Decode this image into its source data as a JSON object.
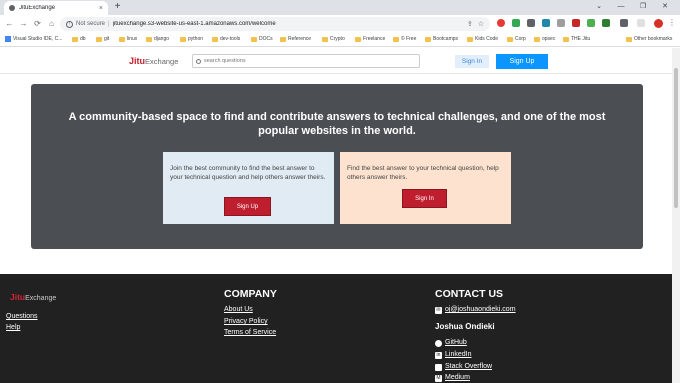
{
  "browser": {
    "tab_title": "JituExchange",
    "tab_close": "×",
    "new_tab": "+",
    "window_controls": [
      "⌄",
      "—",
      "❐",
      "✕"
    ],
    "nav": {
      "back": "←",
      "forward": "→",
      "reload": "⟳",
      "home": "⌂"
    },
    "not_secure": "Not secure",
    "url": "jituexchange.s3-website-us-east-1.amazonaws.com/welcome",
    "bookmarks": [
      "Visual Studio IDE, C...",
      "db",
      "git",
      "linux",
      "django",
      "python",
      "dev-tools",
      "DOCs",
      "Reference",
      "Crypto",
      "Freelance",
      "© Free",
      "Bootcamps",
      "Kids Code",
      "Corp",
      "opsec",
      "THE Jitu"
    ],
    "other_bookmarks": "Other bookmarks"
  },
  "header": {
    "logo_main": "Jitu",
    "logo_sub": "Exchange",
    "search_placeholder": "search questions",
    "signin_label": "Sign In",
    "signup_label": "Sign Up"
  },
  "hero": {
    "title": "A community-based space to find and contribute answers to technical challenges, and one of the most popular websites in the world.",
    "card_left_text": "Join the best community to find the best answer to your technical question and help others answer theirs.",
    "card_left_button": "Sign Up",
    "card_right_text": "Find the best answer to your technical question, help others answer theirs.",
    "card_right_button": "Sign In"
  },
  "footer": {
    "logo_main": "Jitu",
    "logo_sub": "Exchange",
    "links_left": [
      "Questions",
      "Help"
    ],
    "company_heading": "COMPANY",
    "company_links": [
      "About Us",
      "Privacy Policy",
      "Terms of Service"
    ],
    "contact_heading": "CONTACT US",
    "email": "oj@joshuaondieki.com",
    "name": "Joshua Ondieki",
    "socials": [
      "GitHub",
      "LinkedIn",
      "Stack Overflow",
      "Medium"
    ]
  }
}
